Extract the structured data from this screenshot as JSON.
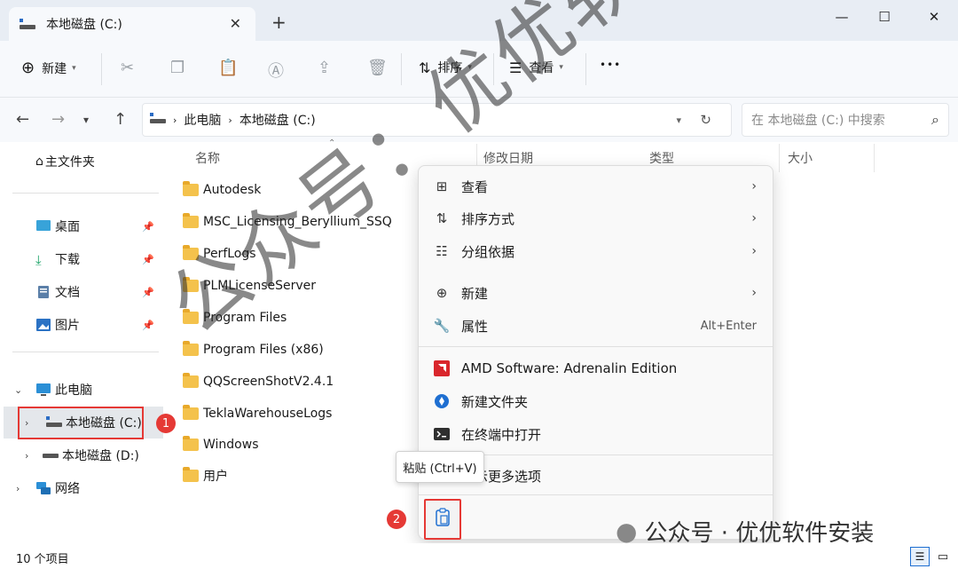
{
  "window": {
    "tab_title": "本地磁盘 (C:)",
    "new_tab": "+",
    "close_tab": "✕",
    "minimize": "—",
    "maximize": "☐",
    "close": "✕"
  },
  "toolbar": {
    "new_label": "新建",
    "sort_label": "排序",
    "view_label": "查看",
    "more_label": "•••"
  },
  "address": {
    "breadcrumb": [
      "此电脑",
      "本地磁盘 (C:)"
    ],
    "search_placeholder": "在 本地磁盘 (C:) 中搜索"
  },
  "sidebar": {
    "home": "主文件夹",
    "quick": [
      {
        "label": "桌面"
      },
      {
        "label": "下载"
      },
      {
        "label": "文档"
      },
      {
        "label": "图片"
      }
    ],
    "this_pc": "此电脑",
    "drives": [
      "本地磁盘 (C:)",
      "本地磁盘 (D:)"
    ],
    "network": "网络"
  },
  "columns": {
    "name": "名称",
    "date": "修改日期",
    "type": "类型",
    "size": "大小"
  },
  "files": [
    "Autodesk",
    "MSC_Licensing_Beryllium_SSQ",
    "PerfLogs",
    "PLMLicenseServer",
    "Program Files",
    "Program Files (x86)",
    "QQScreenShotV2.4.1",
    "TeklaWarehouseLogs",
    "Windows",
    "用户"
  ],
  "context_menu": {
    "view": "查看",
    "sort": "排序方式",
    "group": "分组依据",
    "new": "新建",
    "properties": "属性",
    "properties_shortcut": "Alt+Enter",
    "amd": "AMD Software: Adrenalin Edition",
    "new_folder": "新建文件夹",
    "terminal": "在终端中打开",
    "more_options": "显示更多选项"
  },
  "tooltip": "粘贴 (Ctrl+V)",
  "badges": [
    "1",
    "2"
  ],
  "status": "10 个项目",
  "watermark": "公众号：优优软件安装",
  "watermark_corner": "公众号 · 优优软件安装",
  "colors": {
    "accent_red": "#e53935",
    "folder_yellow": "#f4c24c"
  }
}
